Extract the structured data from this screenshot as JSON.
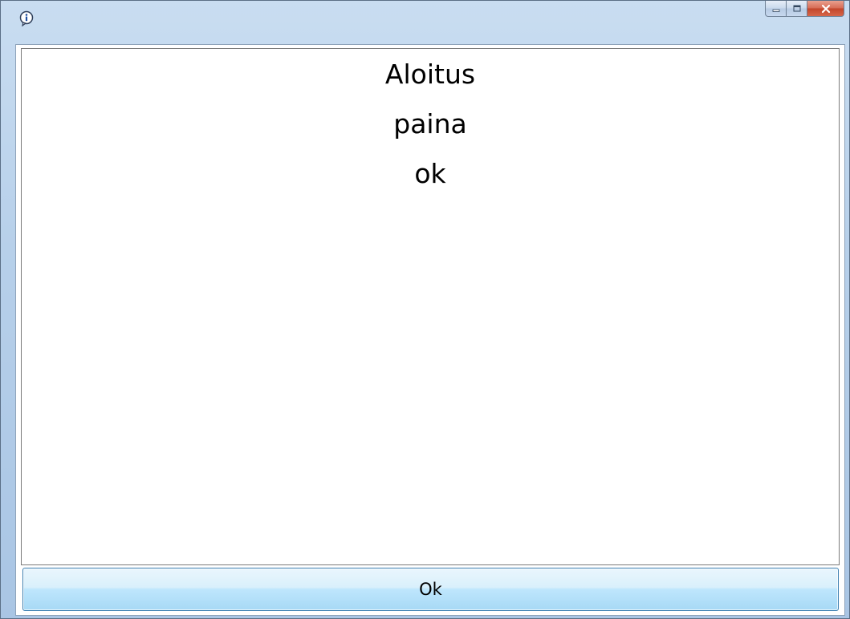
{
  "window": {
    "controls": {
      "minimize_icon": "minimize-icon",
      "maximize_icon": "maximize-icon",
      "close_icon": "close-icon"
    },
    "app_icon": "info-icon"
  },
  "message": {
    "lines": [
      "Aloitus",
      "paina",
      "ok"
    ]
  },
  "buttons": {
    "ok_label": "Ok"
  },
  "colors": {
    "close_accent": "#c2452a",
    "button_border": "#3c7fb1",
    "frame": "#b7d0ea"
  }
}
